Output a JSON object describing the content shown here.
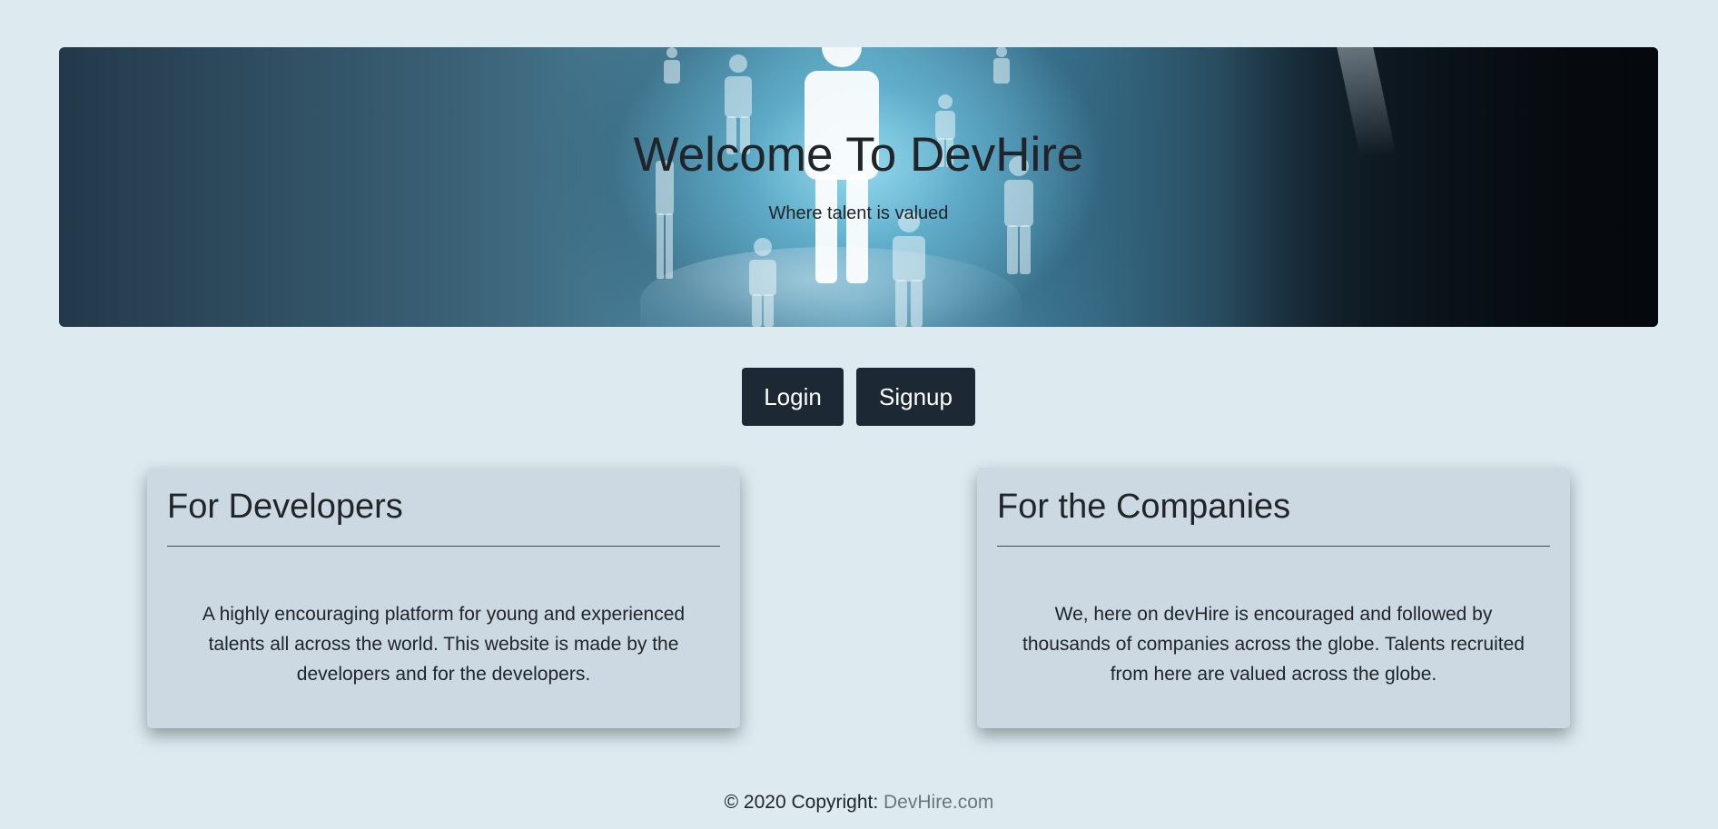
{
  "hero": {
    "title": "Welcome To DevHire",
    "subtitle": "Where talent is valued"
  },
  "buttons": {
    "login": "Login",
    "signup": "Signup"
  },
  "cards": [
    {
      "title": "For Developers",
      "body": "A highly encouraging platform for young and experienced talents all across the world. This website is made by the developers and for the developers."
    },
    {
      "title": "For the Companies",
      "body": "We, here on devHire is encouraged and followed by thousands of companies across the globe. Talents recruited from here are valued across the globe."
    }
  ],
  "footer": {
    "prefix": "© 2020 Copyright: ",
    "link": "DevHire.com"
  },
  "colors": {
    "page_background": "#ddebf1",
    "button_background": "#1c2833",
    "card_background": "#ccd9e2",
    "link": "#6c757d"
  }
}
